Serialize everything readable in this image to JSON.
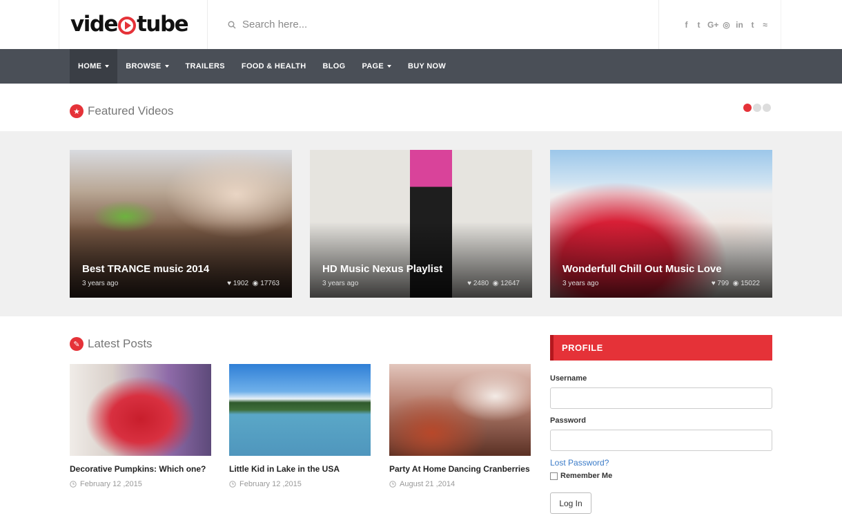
{
  "brand": {
    "logo_left": "vide",
    "logo_right": "tube",
    "accent": "#e53238"
  },
  "search": {
    "placeholder": "Search here..."
  },
  "social": [
    {
      "icon": "facebook-icon",
      "glyph": "f"
    },
    {
      "icon": "twitter-icon",
      "glyph": "t"
    },
    {
      "icon": "google-plus-icon",
      "glyph": "G+"
    },
    {
      "icon": "instagram-icon",
      "glyph": "◎"
    },
    {
      "icon": "linkedin-icon",
      "glyph": "in"
    },
    {
      "icon": "tumblr-icon",
      "glyph": "t"
    },
    {
      "icon": "rss-icon",
      "glyph": "≈"
    }
  ],
  "nav": {
    "items": [
      {
        "label": "HOME",
        "dropdown": true,
        "active": true
      },
      {
        "label": "BROWSE",
        "dropdown": true
      },
      {
        "label": "TRAILERS",
        "dropdown": false
      },
      {
        "label": "FOOD & HEALTH",
        "dropdown": false
      },
      {
        "label": "BLOG",
        "dropdown": false
      },
      {
        "label": "PAGE",
        "dropdown": true
      },
      {
        "label": "BUY NOW",
        "dropdown": false
      }
    ]
  },
  "featured": {
    "title": "Featured Videos",
    "cards": [
      {
        "title": "Best TRANCE music 2014",
        "age": "3 years ago",
        "likes": "1902",
        "views": "17763"
      },
      {
        "title": "HD Music Nexus Playlist",
        "age": "3 years ago",
        "likes": "2480",
        "views": "12647"
      },
      {
        "title": "Wonderfull Chill Out Music Love",
        "age": "3 years ago",
        "likes": "799",
        "views": "15022"
      }
    ]
  },
  "latest": {
    "title": "Latest Posts",
    "posts": [
      {
        "title": "Decorative Pumpkins: Which one?",
        "date": "February 12 ,2015"
      },
      {
        "title": "Little Kid in Lake in the USA",
        "date": "February 12 ,2015"
      },
      {
        "title": "Party At Home Dancing Cranberries",
        "date": "August 21 ,2014"
      }
    ]
  },
  "profile": {
    "heading": "PROFILE",
    "username_label": "Username",
    "password_label": "Password",
    "lost_password": "Lost Password?",
    "remember_me": "Remember Me",
    "login_button": "Log In"
  }
}
